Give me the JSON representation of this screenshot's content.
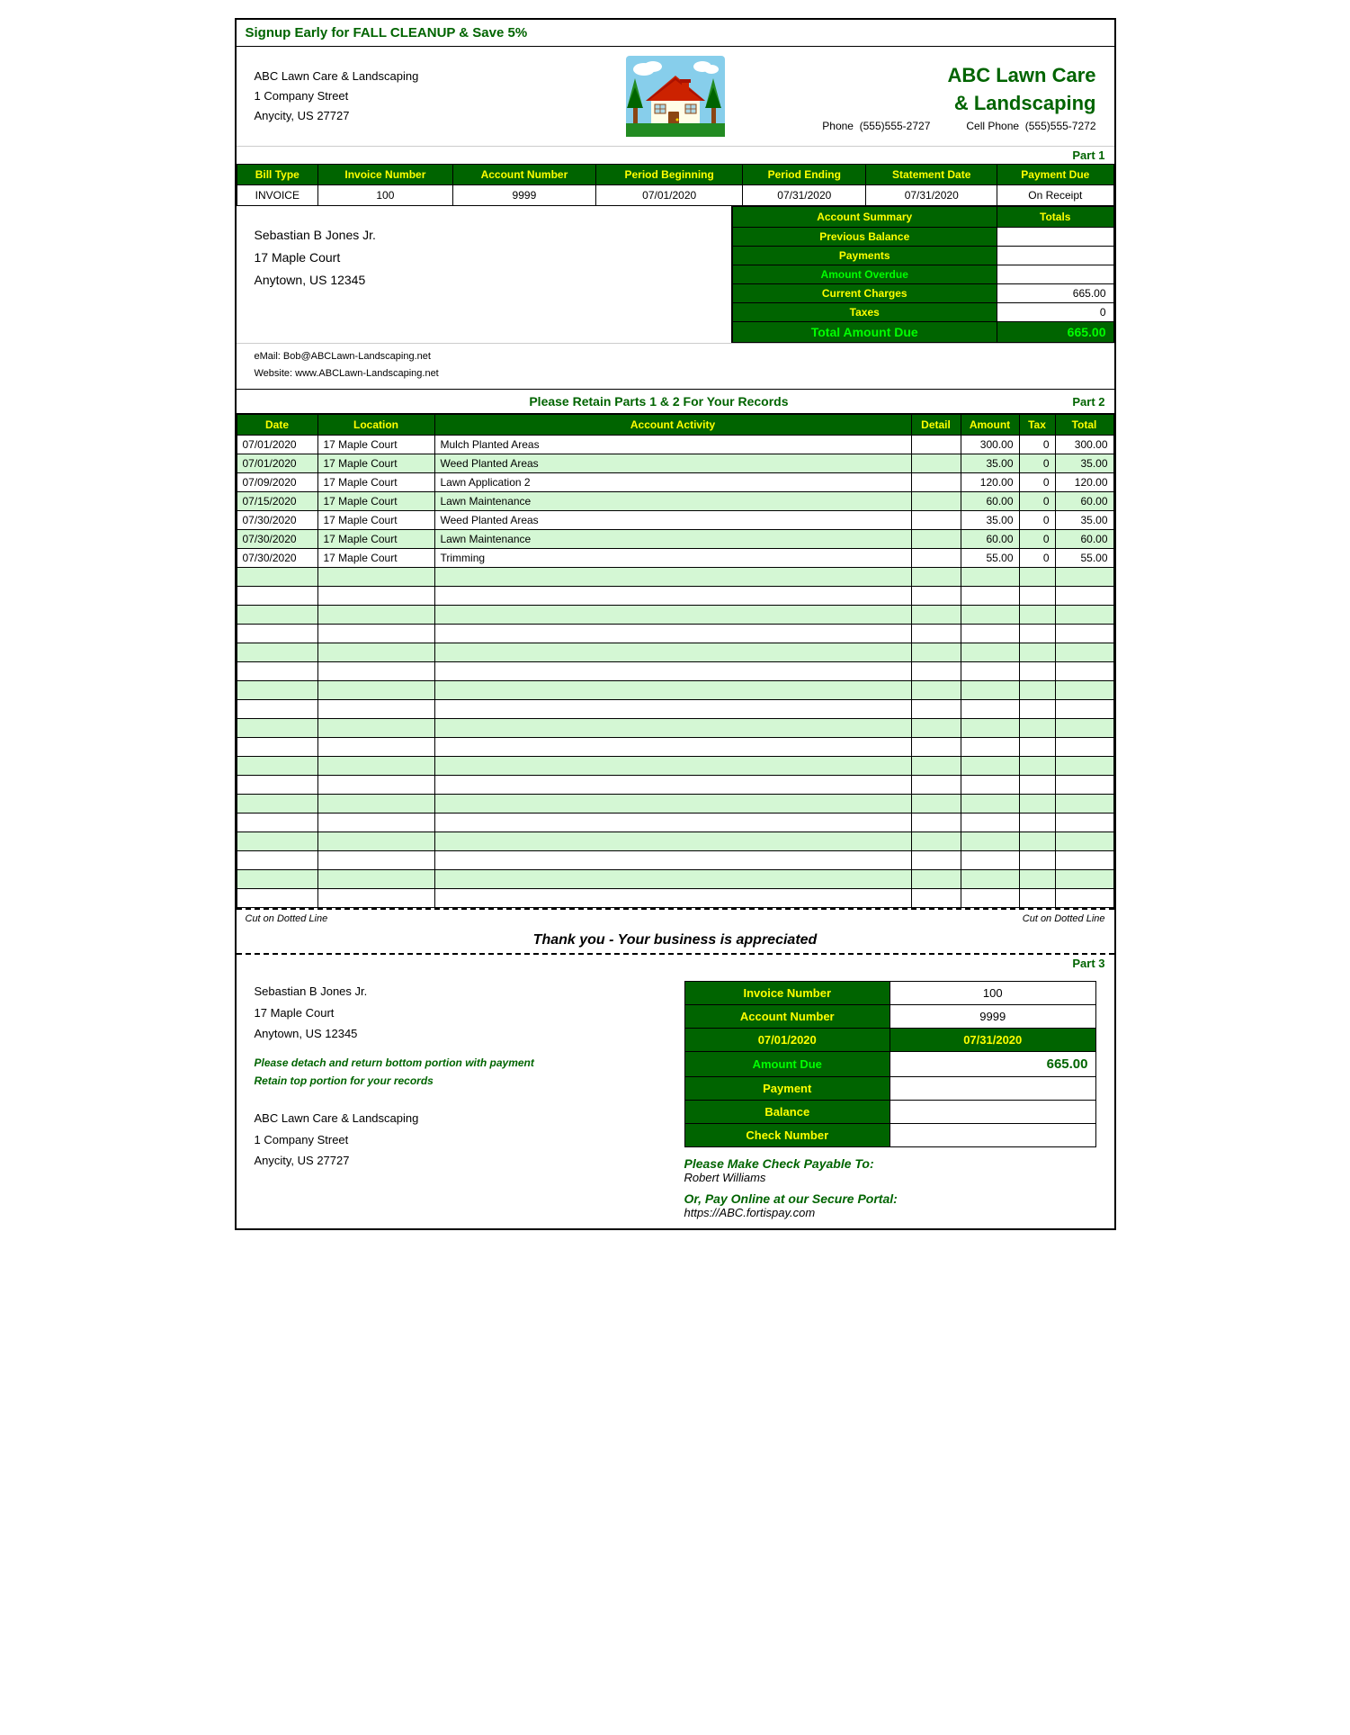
{
  "promo": {
    "text": "Signup Early for FALL CLEANUP & Save 5%"
  },
  "company": {
    "name_line1": "ABC Lawn Care",
    "name_line2": "& Landscaping",
    "address_line1": "ABC Lawn Care & Landscaping",
    "address_line2": "1 Company Street",
    "address_line3": "Anycity, US  27727",
    "phone_label": "Phone",
    "phone": "(555)555-2727",
    "cell_label": "Cell Phone",
    "cell": "(555)555-7272",
    "email": "eMail:  Bob@ABCLawn-Landscaping.net",
    "website": "Website:  www.ABCLawn-Landscaping.net"
  },
  "parts": {
    "part1": "Part 1",
    "part2": "Part 2",
    "part3": "Part 3"
  },
  "bill_info": {
    "headers": [
      "Bill Type",
      "Invoice Number",
      "Account Number",
      "Period Beginning",
      "Period Ending",
      "Statement Date",
      "Payment Due"
    ],
    "values": [
      "INVOICE",
      "100",
      "9999",
      "07/01/2020",
      "07/31/2020",
      "07/31/2020",
      "On Receipt"
    ]
  },
  "customer": {
    "name": "Sebastian B Jones Jr.",
    "address1": "17 Maple Court",
    "address2": "Anytown, US  12345"
  },
  "account_summary": {
    "title": "Account Summary",
    "totals_label": "Totals",
    "rows": [
      {
        "label": "Previous Balance",
        "value": ""
      },
      {
        "label": "Payments",
        "value": ""
      },
      {
        "label": "Amount Overdue",
        "value": ""
      },
      {
        "label": "Current Charges",
        "value": "665.00"
      },
      {
        "label": "Taxes",
        "value": "0"
      }
    ],
    "total_label": "Total Amount Due",
    "total_value": "665.00"
  },
  "retain_text": "Please Retain Parts 1 & 2 For Your Records",
  "activity": {
    "headers": [
      "Date",
      "Location",
      "Account Activity",
      "Detail",
      "Amount",
      "Tax",
      "Total"
    ],
    "rows": [
      {
        "date": "07/01/2020",
        "location": "17 Maple Court",
        "activity": "Mulch Planted Areas",
        "detail": "",
        "amount": "300.00",
        "tax": "0",
        "total": "300.00"
      },
      {
        "date": "07/01/2020",
        "location": "17 Maple Court",
        "activity": "Weed Planted Areas",
        "detail": "",
        "amount": "35.00",
        "tax": "0",
        "total": "35.00"
      },
      {
        "date": "07/09/2020",
        "location": "17 Maple Court",
        "activity": "Lawn Application 2",
        "detail": "",
        "amount": "120.00",
        "tax": "0",
        "total": "120.00"
      },
      {
        "date": "07/15/2020",
        "location": "17 Maple Court",
        "activity": "Lawn Maintenance",
        "detail": "",
        "amount": "60.00",
        "tax": "0",
        "total": "60.00"
      },
      {
        "date": "07/30/2020",
        "location": "17 Maple Court",
        "activity": "Weed Planted Areas",
        "detail": "",
        "amount": "35.00",
        "tax": "0",
        "total": "35.00"
      },
      {
        "date": "07/30/2020",
        "location": "17 Maple Court",
        "activity": "Lawn Maintenance",
        "detail": "",
        "amount": "60.00",
        "tax": "0",
        "total": "60.00"
      },
      {
        "date": "07/30/2020",
        "location": "17 Maple Court",
        "activity": "Trimming",
        "detail": "",
        "amount": "55.00",
        "tax": "0",
        "total": "55.00"
      }
    ],
    "empty_rows": 18
  },
  "cut_line": {
    "left": "Cut on Dotted Line",
    "right": "Cut on Dotted Line"
  },
  "thank_you": "Thank you - Your business is appreciated",
  "part3": {
    "customer_name": "Sebastian B Jones Jr.",
    "address1": "17 Maple Court",
    "address2": "Anytown, US  12345",
    "detach_line1": "Please detach and return bottom portion with payment",
    "detach_line2": "Retain top portion for your records",
    "mail_address1": "ABC Lawn Care & Landscaping",
    "mail_address2": "1 Company Street",
    "mail_address3": "Anycity, US   27727",
    "invoice_label": "Invoice Number",
    "invoice_value": "100",
    "account_label": "Account Number",
    "account_value": "9999",
    "period_begin": "07/01/2020",
    "period_end": "07/31/2020",
    "amount_label": "Amount Due",
    "amount_value": "665.00",
    "payment_label": "Payment",
    "payment_value": "",
    "balance_label": "Balance",
    "balance_value": "",
    "check_label": "Check Number",
    "check_value": "",
    "pay_check_label": "Please Make Check Payable To:",
    "pay_check_name": "Robert Williams",
    "pay_online_label": "Or, Pay Online at our Secure Portal:",
    "pay_online_url": "https://ABC.fortispay.com"
  }
}
